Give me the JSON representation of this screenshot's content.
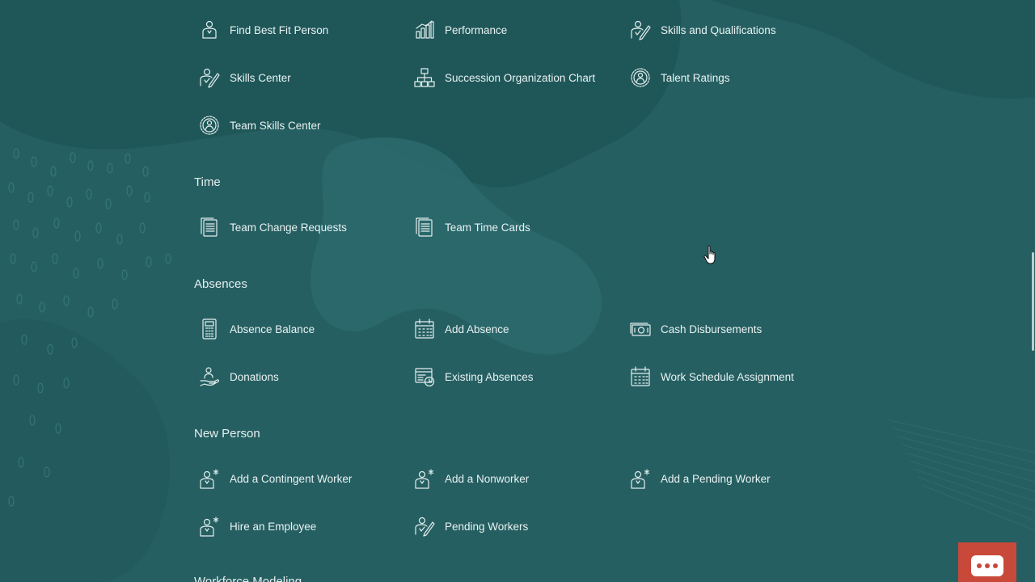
{
  "sections": {
    "talent": {
      "items": [
        {
          "label": "Find Best Fit Person",
          "icon": "person-badge-icon"
        },
        {
          "label": "Performance",
          "icon": "bar-chart-icon"
        },
        {
          "label": "Skills and Qualifications",
          "icon": "skills-pencil-icon"
        },
        {
          "label": "Skills Center",
          "icon": "skills-pencil-icon"
        },
        {
          "label": "Succession Organization Chart",
          "icon": "org-chart-icon"
        },
        {
          "label": "Talent Ratings",
          "icon": "gear-person-icon"
        },
        {
          "label": "Team Skills Center",
          "icon": "gear-person-icon"
        }
      ]
    },
    "time": {
      "title": "Time",
      "items": [
        {
          "label": "Team Change Requests",
          "icon": "document-icon"
        },
        {
          "label": "Team Time Cards",
          "icon": "document-icon"
        }
      ]
    },
    "absences": {
      "title": "Absences",
      "items": [
        {
          "label": "Absence Balance",
          "icon": "calculator-icon"
        },
        {
          "label": "Add Absence",
          "icon": "calendar-icon"
        },
        {
          "label": "Cash Disbursements",
          "icon": "cash-icon"
        },
        {
          "label": "Donations",
          "icon": "donation-hand-icon"
        },
        {
          "label": "Existing Absences",
          "icon": "calendar-clock-icon"
        },
        {
          "label": "Work Schedule Assignment",
          "icon": "calendar-icon"
        }
      ]
    },
    "new_person": {
      "title": "New Person",
      "items": [
        {
          "label": "Add a Contingent Worker",
          "icon": "add-person-icon"
        },
        {
          "label": "Add a Nonworker",
          "icon": "add-person-icon"
        },
        {
          "label": "Add a Pending Worker",
          "icon": "add-person-icon"
        },
        {
          "label": "Hire an Employee",
          "icon": "add-person-icon"
        },
        {
          "label": "Pending Workers",
          "icon": "skills-pencil-icon"
        }
      ]
    },
    "workforce_modeling": {
      "title": "Workforce Modeling"
    }
  },
  "colors": {
    "background": "#255f62",
    "text": "#eaf2f2",
    "chat_button": "#c8493a"
  }
}
